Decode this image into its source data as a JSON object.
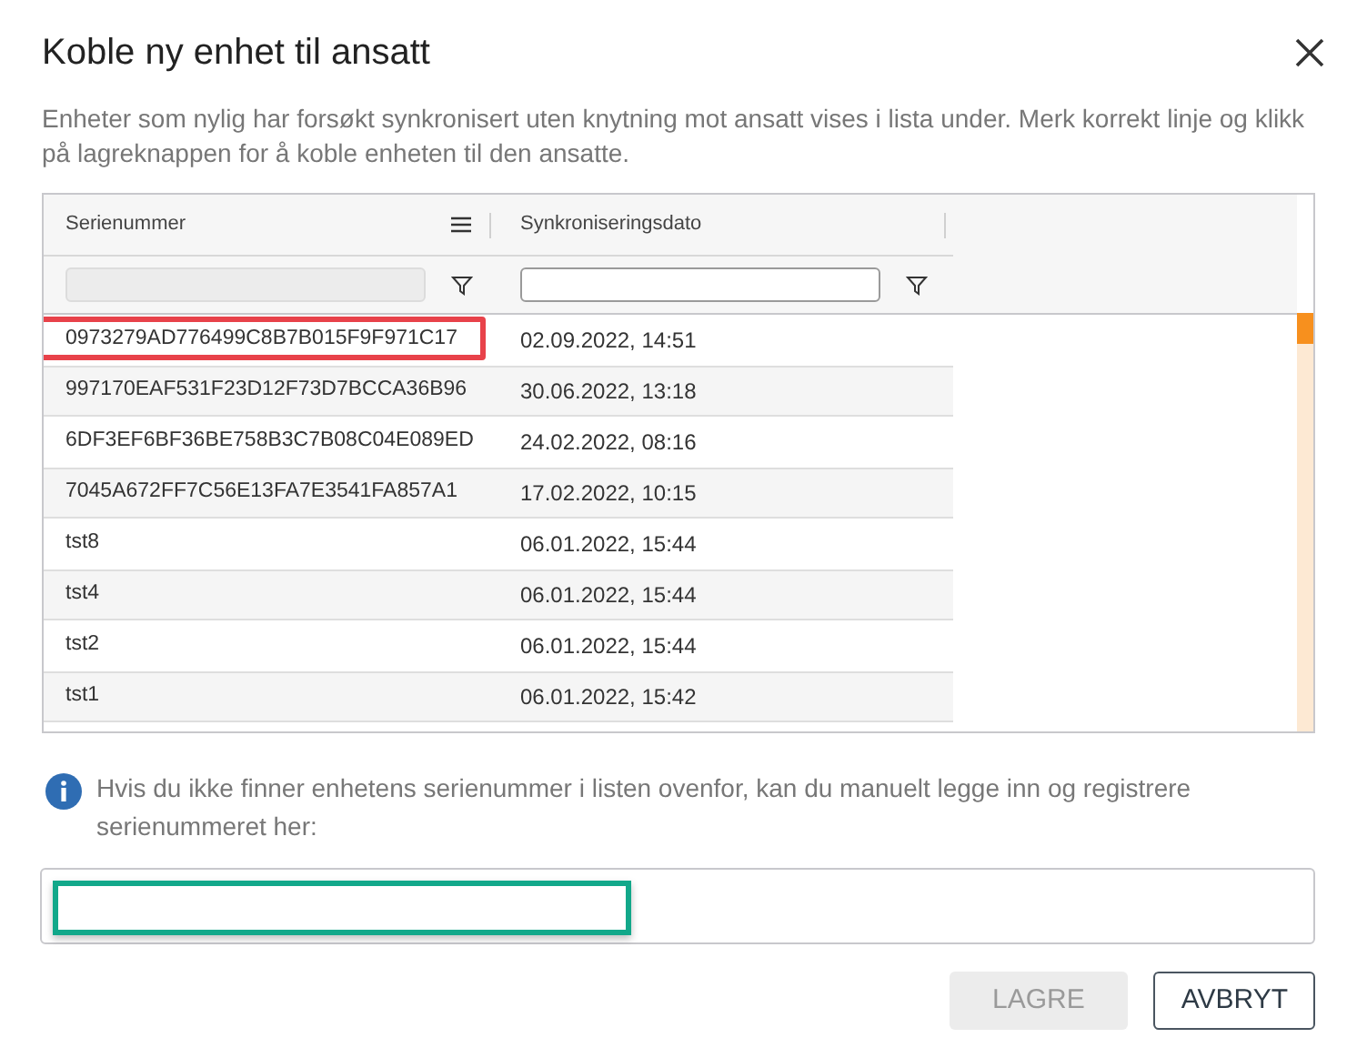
{
  "dialog": {
    "title": "Koble ny enhet til ansatt",
    "description": "Enheter som nylig har forsøkt synkronisert uten knytning mot ansatt vises i lista under. Merk korrekt linje og klikk på lagreknappen for å koble enheten til den ansatte."
  },
  "table": {
    "columns": [
      {
        "label": "Serienummer",
        "menu": true,
        "filter_disabled": true
      },
      {
        "label": "Synkroniseringsdato",
        "menu": false,
        "filter_disabled": false
      }
    ],
    "rows": [
      {
        "cells": [
          "0973279AD776499C8B7B015F9F971C17",
          "02.09.2022, 14:51"
        ],
        "highlighted": true
      },
      {
        "cells": [
          "997170EAF531F23D12F73D7BCCA36B96",
          "30.06.2022, 13:18"
        ],
        "highlighted": false
      },
      {
        "cells": [
          "6DF3EF6BF36BE758B3C7B08C04E089ED",
          "24.02.2022, 08:16"
        ],
        "highlighted": false
      },
      {
        "cells": [
          "7045A672FF7C56E13FA7E3541FA857A1",
          "17.02.2022, 10:15"
        ],
        "highlighted": false
      },
      {
        "cells": [
          "tst8",
          "06.01.2022, 15:44"
        ],
        "highlighted": false
      },
      {
        "cells": [
          "tst4",
          "06.01.2022, 15:44"
        ],
        "highlighted": false
      },
      {
        "cells": [
          "tst2",
          "06.01.2022, 15:44"
        ],
        "highlighted": false
      },
      {
        "cells": [
          "tst1",
          "06.01.2022, 15:42"
        ],
        "highlighted": false
      }
    ]
  },
  "info": {
    "text": "Hvis du ikke finner enhetens serienummer i listen ovenfor, kan du manuelt legge inn og registrere serienummeret her:"
  },
  "manual_input": {
    "highlighted": true
  },
  "buttons": [
    {
      "label": "LAGRE",
      "disabled": true
    },
    {
      "label": "AVBRYT",
      "disabled": false
    }
  ]
}
